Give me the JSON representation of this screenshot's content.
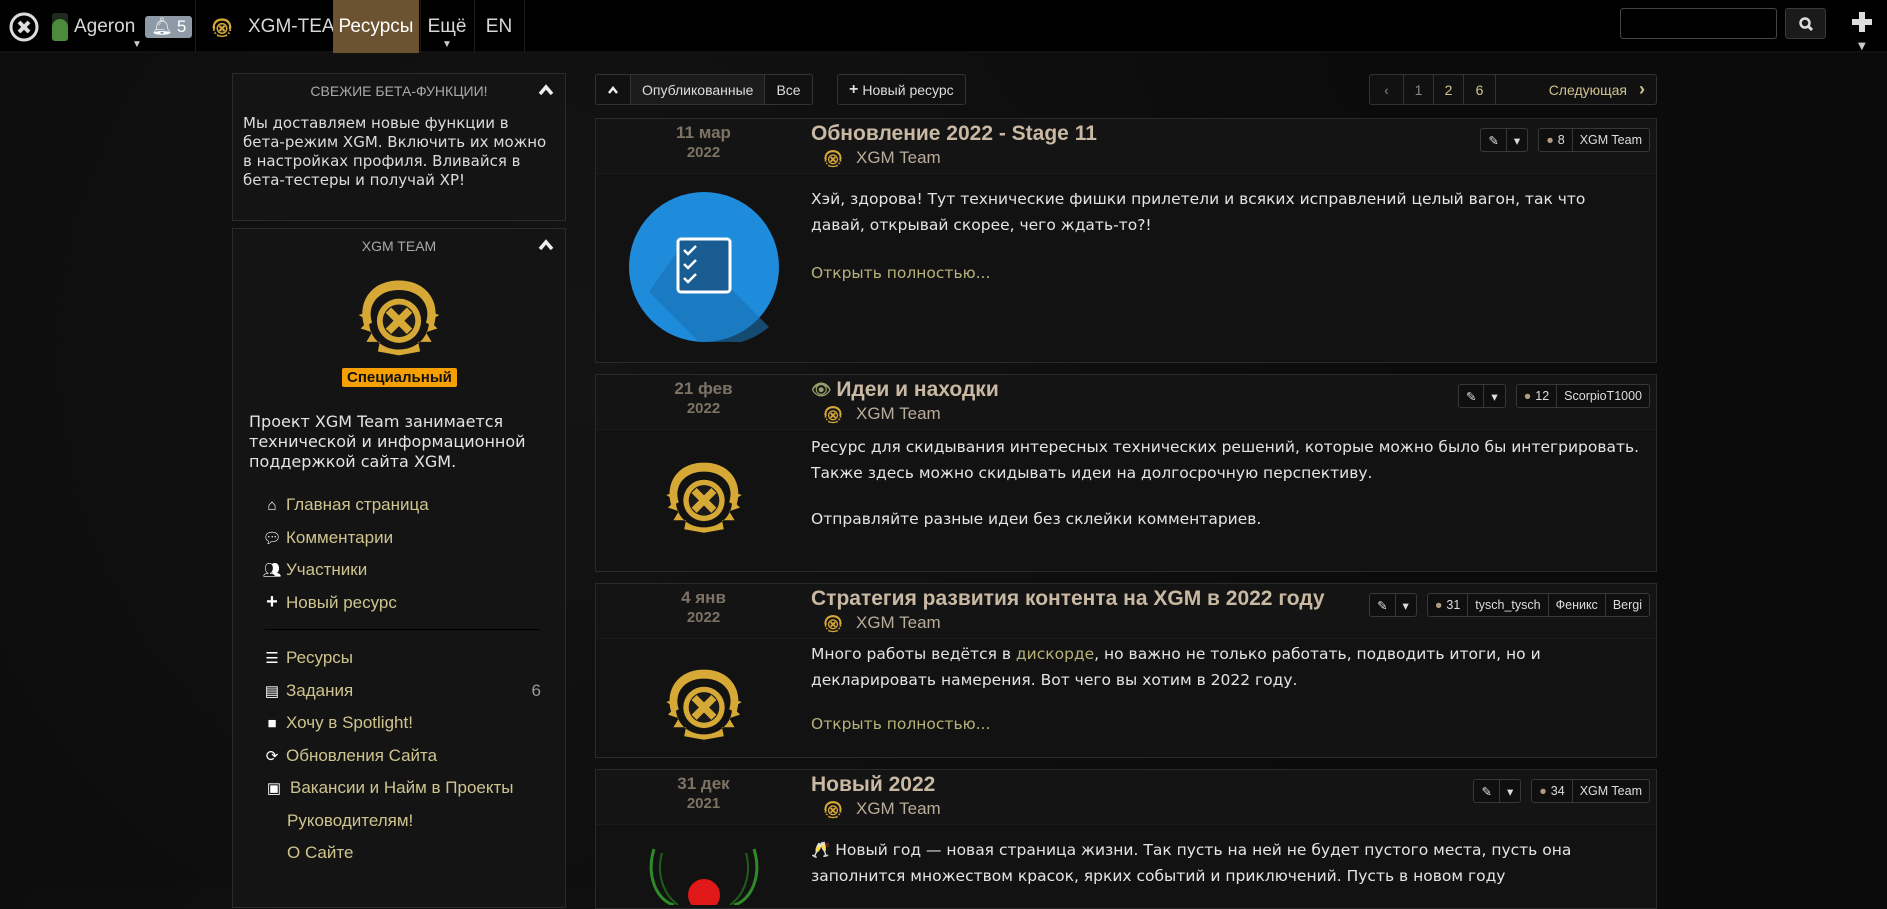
{
  "topbar": {
    "user": "Ageron",
    "notifications": "5",
    "group": "XGM-TEAM",
    "active_tab": "Ресурсы",
    "more": "Ещё",
    "lang": "EN",
    "search_placeholder": "",
    "search_value": ""
  },
  "toolbar": {
    "published": "Опубликованные",
    "all": "Все",
    "new_resource": "Новый ресурс"
  },
  "pagination": {
    "pages": [
      "1",
      "2",
      "6"
    ],
    "current": "1",
    "next": "Следующая"
  },
  "sidebar": {
    "beta": {
      "title": "СВЕЖИЕ БЕТА-ФУНКЦИИ!",
      "text": "Мы доставляем новые функции в бета-режим XGM. Включить их можно в настройках профиля. Вливайся в бета-тестеры и получай XP!"
    },
    "team": {
      "title": "XGM TEAM",
      "badge": "Специальный",
      "description": "Проект XGM Team занимается технической и информационной поддержкой сайта XGM."
    },
    "nav_top": [
      {
        "label": "Главная страница",
        "icon": "home-icon"
      },
      {
        "label": "Комментарии",
        "icon": "comments-icon"
      },
      {
        "label": "Участники",
        "icon": "users-icon"
      },
      {
        "label": "Новый ресурс",
        "icon": "plus-icon"
      }
    ],
    "nav_bottom": [
      {
        "label": "Ресурсы",
        "icon": "list-icon"
      },
      {
        "label": "Задания",
        "icon": "tasks-icon",
        "count": "6"
      },
      {
        "label": "Хочу в Spotlight!",
        "icon": "video-icon"
      },
      {
        "label": "Обновления Сайта",
        "icon": "refresh-icon"
      },
      {
        "label": "Вакансии и Найм в Проекты",
        "icon": "id-card-icon"
      },
      {
        "label": "Руководителям!"
      },
      {
        "label": "О Сайте"
      }
    ]
  },
  "posts": [
    {
      "day": "11 мар",
      "year": "2022",
      "title": "Обновление 2022 - Stage 11",
      "author": "XGM Team",
      "comments": "8",
      "participants": [
        "XGM Team"
      ],
      "paragraphs": [
        "Хэй, здорова! Тут технические фишки прилетели и всяких исправлений целый вагон, так что давай, открывай скорее, чего ждать-то?!"
      ],
      "more": "Открыть полностью..."
    },
    {
      "day": "21 фев",
      "year": "2022",
      "title": "Идеи и находки",
      "author": "XGM Team",
      "comments": "12",
      "participants": [
        "ScorpioT1000"
      ],
      "paragraphs": [
        "Ресурс для скидывания интересных технических решений, которые можно было бы интегрировать.",
        "Также здесь можно скидывать идеи на долгосрочную перспективу.",
        "Отправляйте разные идеи без склейки комментариев."
      ]
    },
    {
      "day": "4 янв",
      "year": "2022",
      "title": "Стратегия развития контента на XGM в 2022 году",
      "author": "XGM Team",
      "comments": "31",
      "participants": [
        "tysch_tysch",
        "Феникс",
        "Bergi"
      ],
      "text_before": "Много работы ведётся в ",
      "link": "дискорде",
      "text_after": ", но важно не только работать, подводить итоги, но и декларировать намерения. Вот чего вы хотим в 2022 году.",
      "more": "Открыть полностью..."
    },
    {
      "day": "31 дек",
      "year": "2021",
      "title": "Новый 2022",
      "author": "XGM Team",
      "comments": "34",
      "participants": [
        "XGM Team"
      ],
      "paragraphs": [
        "🥂 Новый год — новая страница жизни. Так пусть на ней не будет пустого места, пусть она заполнится множеством красок, ярких событий и приключений. Пусть в новом году"
      ]
    }
  ],
  "colors": {
    "accent_brown": "#6b5331",
    "link": "#cfc48e",
    "gold": "#d8a93a",
    "badge": "#f5a000",
    "blue": "#1e8bdb"
  }
}
